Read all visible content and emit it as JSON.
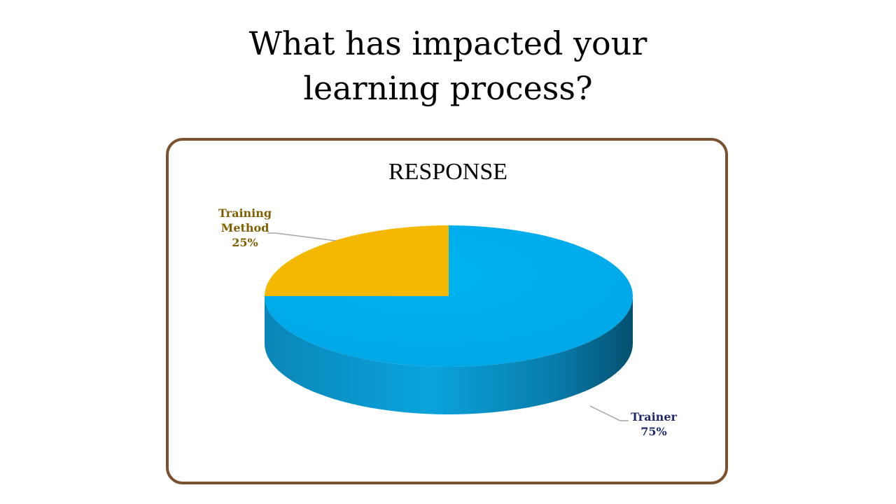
{
  "slide": {
    "title_line1": "What has impacted your",
    "title_line2": "learning process?"
  },
  "colors": {
    "frame": "#7a5230",
    "trainer": "#00b0f0",
    "trainer_side": "#0a86b8",
    "training_method": "#f5b800",
    "trainer_label": "#1f2a6b",
    "training_method_label": "#7f6000"
  },
  "chart_data": {
    "type": "pie",
    "title": "RESPONSE",
    "three_d": true,
    "slices": [
      {
        "name": "Training Method",
        "value": 25,
        "label_lines": [
          "Training",
          "Method",
          "25%"
        ],
        "color": "#f5b800",
        "label_color": "#7f6000"
      },
      {
        "name": "Trainer",
        "value": 75,
        "label_lines": [
          "Trainer",
          "75%"
        ],
        "color": "#00b0f0",
        "label_color": "#1f2a6b"
      }
    ]
  }
}
